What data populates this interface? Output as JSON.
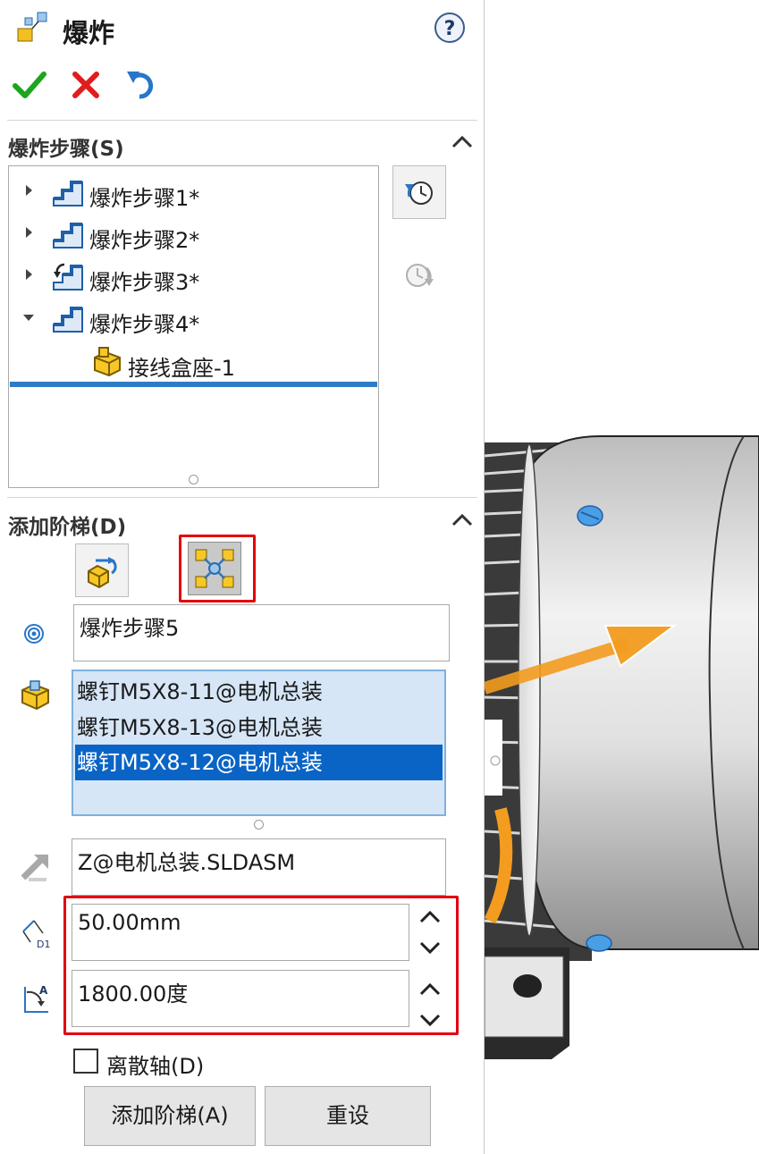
{
  "header": {
    "title": "爆炸",
    "help_label": "?"
  },
  "actions": {
    "ok": "ok",
    "cancel": "cancel",
    "undo": "undo"
  },
  "steps_section": {
    "title": "爆炸步骤(S)",
    "items": [
      {
        "label": "爆炸步骤1*",
        "expanded": false
      },
      {
        "label": "爆炸步骤2*",
        "expanded": false
      },
      {
        "label": "爆炸步骤3*",
        "expanded": false
      },
      {
        "label": "爆炸步骤4*",
        "expanded": true
      }
    ],
    "child": {
      "label": "接线盒座-1"
    }
  },
  "ladder_section": {
    "title": "添加阶梯(D)",
    "step_name": "爆炸步骤5",
    "components": [
      "螺钉M5X8-11@电机总装",
      "螺钉M5X8-13@电机总装",
      "螺钉M5X8-12@电机总装"
    ],
    "selected_index": 2,
    "direction": "Z@电机总装.SLDASM",
    "distance": "50.00mm",
    "angle": "1800.00度",
    "distance_icon_label": "D1",
    "angle_icon_label": "A",
    "discrete_axis_label": "离散轴(D)",
    "discrete_axis_checked": false,
    "add_button": "添加阶梯(A)",
    "reset_button": "重设"
  },
  "colors": {
    "selection": "#0a64c6",
    "highlight_box": "#e3000f",
    "arrow": "#f39c1f",
    "ok": "#1ea41e",
    "cancel": "#e01d1d"
  }
}
